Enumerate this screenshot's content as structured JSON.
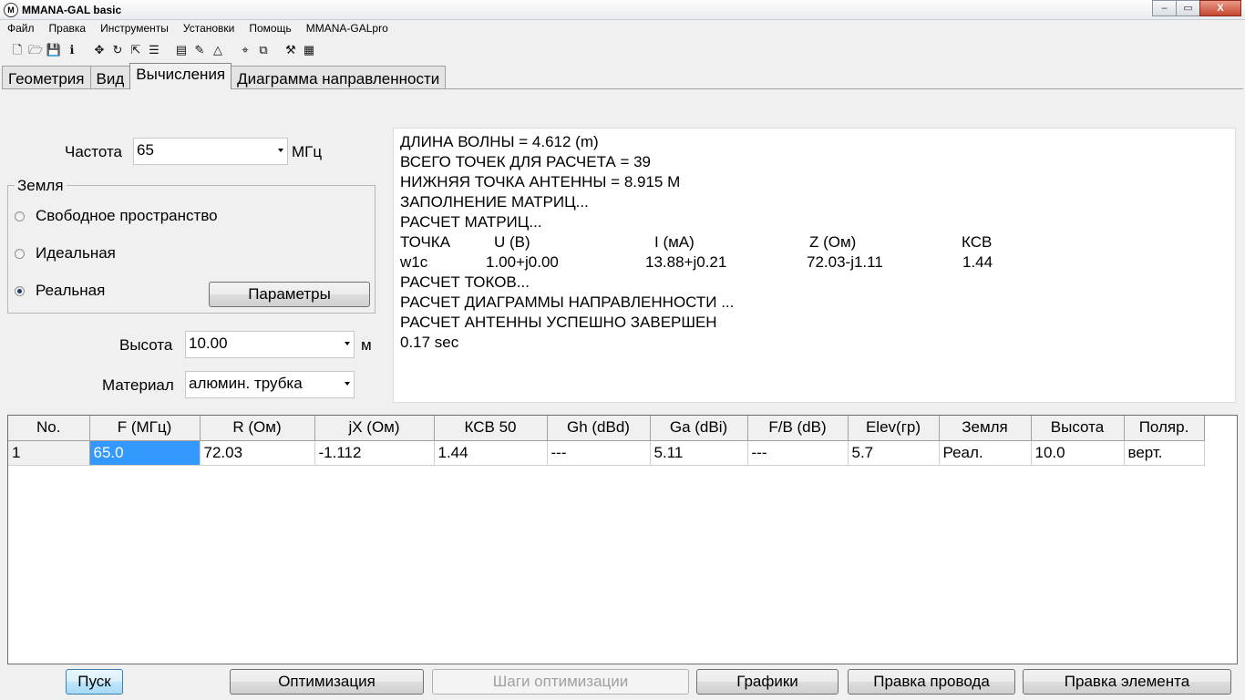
{
  "window": {
    "title": "MMANA-GAL basic",
    "buttons": [
      "–",
      "▭",
      "X"
    ]
  },
  "menu": [
    "Файл",
    "Правка",
    "Инструменты",
    "Установки",
    "Помощь",
    "MMANA-GALpro"
  ],
  "toolbar": [
    {
      "icon": "new-file-icon",
      "glyph": "🗋"
    },
    {
      "icon": "open-folder-icon",
      "glyph": "🗁"
    },
    {
      "icon": "save-icon",
      "glyph": "💾"
    },
    {
      "icon": "info-icon",
      "glyph": "ℹ"
    },
    {
      "icon": "sep"
    },
    {
      "icon": "move-icon",
      "glyph": "✥"
    },
    {
      "icon": "rotate-icon",
      "glyph": "↻"
    },
    {
      "icon": "scale-icon",
      "glyph": "⇱"
    },
    {
      "icon": "elements-icon",
      "glyph": "☰"
    },
    {
      "icon": "sep"
    },
    {
      "icon": "page-icon",
      "glyph": "▤"
    },
    {
      "icon": "edit-icon",
      "glyph": "✎"
    },
    {
      "icon": "triangle-icon",
      "glyph": "△"
    },
    {
      "icon": "sep"
    },
    {
      "icon": "crosshair-icon",
      "glyph": "⌖"
    },
    {
      "icon": "copy-icon",
      "glyph": "⧉"
    },
    {
      "icon": "sep"
    },
    {
      "icon": "tools-icon",
      "glyph": "⚒"
    },
    {
      "icon": "calculator-icon",
      "glyph": "▦"
    }
  ],
  "tabs": [
    {
      "label": "Геометрия",
      "active": false
    },
    {
      "label": "Вид",
      "active": false
    },
    {
      "label": "Вычисления",
      "active": true
    },
    {
      "label": "Диаграмма направленности",
      "active": false
    }
  ],
  "calc": {
    "frequency_label": "Частота",
    "frequency_value": "65",
    "frequency_unit": "МГц",
    "ground_title": "Земля",
    "ground_options": [
      {
        "label": "Свободное пространство",
        "selected": false
      },
      {
        "label": "Идеальная",
        "selected": false
      },
      {
        "label": "Реальная",
        "selected": true
      }
    ],
    "params_button": "Параметры",
    "height_label": "Высота",
    "height_value": "10.00",
    "height_unit": "м",
    "material_label": "Материал",
    "material_value": "алюмин. трубка"
  },
  "output": {
    "lines": [
      "ДЛИНА ВОЛНЫ = 4.612 (m)",
      "ВСЕГО ТОЧЕК ДЛЯ РАСЧЕТА = 39",
      "НИЖНЯЯ ТОЧКА АНТЕННЫ = 8.915 М",
      "ЗАПОЛНЕНИЕ МАТРИЦ...",
      "РАСЧЕТ МАТРИЦ..."
    ],
    "table_header": [
      "ТОЧКА",
      "U (В)",
      "I (мА)",
      "Z (Ом)",
      "КСВ"
    ],
    "table_row": [
      "w1c",
      "1.00+j0.00",
      "13.88+j0.21",
      "72.03-j1.11",
      "1.44"
    ],
    "tail_lines": [
      "РАСЧЕТ ТОКОВ...",
      "РАСЧЕТ ДИАГРАММЫ НАПРАВЛЕННОСТИ ...",
      "РАСЧЕТ АНТЕННЫ УСПЕШНО ЗАВЕРШЕН",
      "0.17 sec"
    ]
  },
  "grid": {
    "columns": [
      "No.",
      "F (МГц)",
      "R (Ом)",
      "jX (Ом)",
      "КСВ 50",
      "Gh (dBd)",
      "Ga (dBi)",
      "F/B (dB)",
      "Elev(гр)",
      "Земля",
      "Высота",
      "Поляр."
    ],
    "rows": [
      [
        "1",
        "65.0",
        "72.03",
        "-1.112",
        "1.44",
        "---",
        "5.11",
        "---",
        "5.7",
        "Реал.",
        "10.0",
        "верт."
      ]
    ]
  },
  "buttons": {
    "start": "Пуск",
    "optimize": "Оптимизация",
    "opt_steps": "Шаги оптимизации",
    "graphs": "Графики",
    "edit_wire": "Правка провода",
    "edit_element": "Правка элемента"
  }
}
